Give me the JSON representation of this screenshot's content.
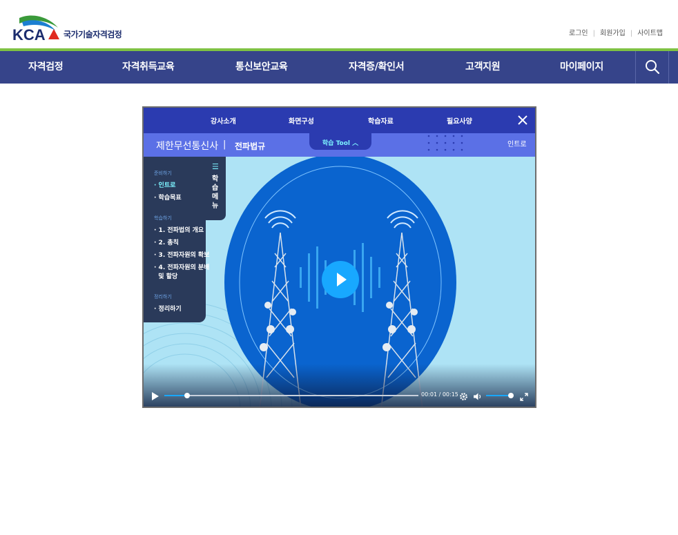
{
  "header": {
    "logo_text": "KCA",
    "logo_sub": "국가기술자격검정",
    "util": [
      {
        "label": "로그인"
      },
      {
        "label": "회원가입"
      },
      {
        "label": "사이트맵"
      }
    ]
  },
  "gnb": {
    "items": [
      {
        "label": "자격검정"
      },
      {
        "label": "자격취득교육"
      },
      {
        "label": "통신보안교육"
      },
      {
        "label": "자격증/확인서"
      },
      {
        "label": "고객지원"
      },
      {
        "label": "마이페이지"
      }
    ],
    "search_icon": "search-icon"
  },
  "player": {
    "top_menu": [
      {
        "label": "강사소개"
      },
      {
        "label": "화면구성"
      },
      {
        "label": "학습자료"
      },
      {
        "label": "필요사양"
      }
    ],
    "course_title": "제한무선통신사",
    "divider": "|",
    "chapter_title": "전파법규",
    "tool_label": "학습 Tool",
    "current_page": "인트로",
    "menu_tab_label": "학습메뉴",
    "menu": {
      "sections": [
        {
          "title": "준비하기",
          "items": [
            "· 인트로",
            "· 학습목표"
          ]
        },
        {
          "title": "학습하기",
          "items": [
            "· 1. 전파법의 개요",
            "· 2. 총칙",
            "· 3. 전파자원의 확보",
            "· 4. 전파자원의 분배",
            "  및 할당"
          ]
        },
        {
          "title": "정리하기",
          "items": [
            "· 정리하기"
          ]
        }
      ]
    },
    "controls": {
      "time": "00:01 / 00:15",
      "progress": 0.09,
      "volume": 0.95
    },
    "colors": {
      "top_bar": "#2b3bb0",
      "title_bar": "#5b70e6",
      "accent": "#18a8ff",
      "menu_bg": "#2a3a5a"
    }
  }
}
